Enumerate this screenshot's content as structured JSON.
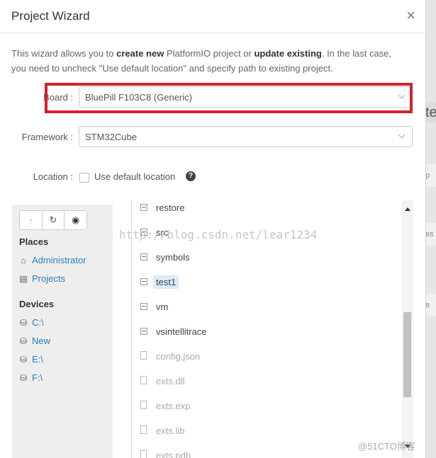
{
  "dialog": {
    "title": "Project Wizard",
    "close_glyph": "×",
    "intro": {
      "part1": "This wizard allows you to ",
      "bold1": "create new",
      "part2": " PlatformIO project or ",
      "bold2": "update existing",
      "part3": ". In the last case, you need to uncheck \"Use default location\" and specify path to existing project."
    }
  },
  "form": {
    "board_label": "Board :",
    "board_value": "BluePill F103C8 (Generic)",
    "framework_label": "Framework :",
    "framework_value": "STM32Cube",
    "location_label": "Location :",
    "use_default_label": "Use default location",
    "use_default_checked": false,
    "help_glyph": "?"
  },
  "browser": {
    "toolbar": [
      {
        "name": "up",
        "glyph": "↑"
      },
      {
        "name": "refresh",
        "glyph": "↻"
      },
      {
        "name": "eye",
        "glyph": "◉"
      }
    ],
    "places_heading": "Places",
    "places": [
      {
        "label": "Administrator",
        "icon": "home-icon",
        "glyph": "⌂"
      },
      {
        "label": "Projects",
        "icon": "folder-icon",
        "glyph": "▤"
      }
    ],
    "devices_heading": "Devices",
    "devices": [
      {
        "label": "C:\\",
        "icon": "drive-icon",
        "glyph": "⛁"
      },
      {
        "label": "New",
        "icon": "drive-icon",
        "glyph": "⛁"
      },
      {
        "label": "E:\\",
        "icon": "drive-icon",
        "glyph": "⛁"
      },
      {
        "label": "F:\\",
        "icon": "drive-icon",
        "glyph": "⛁"
      }
    ],
    "entries": [
      {
        "name": "restore",
        "type": "folder"
      },
      {
        "name": "src",
        "type": "folder"
      },
      {
        "name": "symbols",
        "type": "folder"
      },
      {
        "name": "test1",
        "type": "folder",
        "selected": true
      },
      {
        "name": "vm",
        "type": "folder"
      },
      {
        "name": "vsintellitrace",
        "type": "folder"
      },
      {
        "name": "config.json",
        "type": "file"
      },
      {
        "name": "exts.dll",
        "type": "file"
      },
      {
        "name": "exts.exp",
        "type": "file"
      },
      {
        "name": "exts.lib",
        "type": "file"
      },
      {
        "name": "exts.pdb",
        "type": "file"
      }
    ]
  },
  "watermarks": {
    "blog": "http://blog.csdn.net/lear1234",
    "site": "@51CTO博客"
  },
  "backdrop": {
    "strip1": "te",
    "strip2": "p",
    "strip3": "es",
    "strip4": "e"
  },
  "colors": {
    "highlight": "#d3212c",
    "link": "#2a7fbf",
    "selected_bg": "#dcebf8"
  }
}
